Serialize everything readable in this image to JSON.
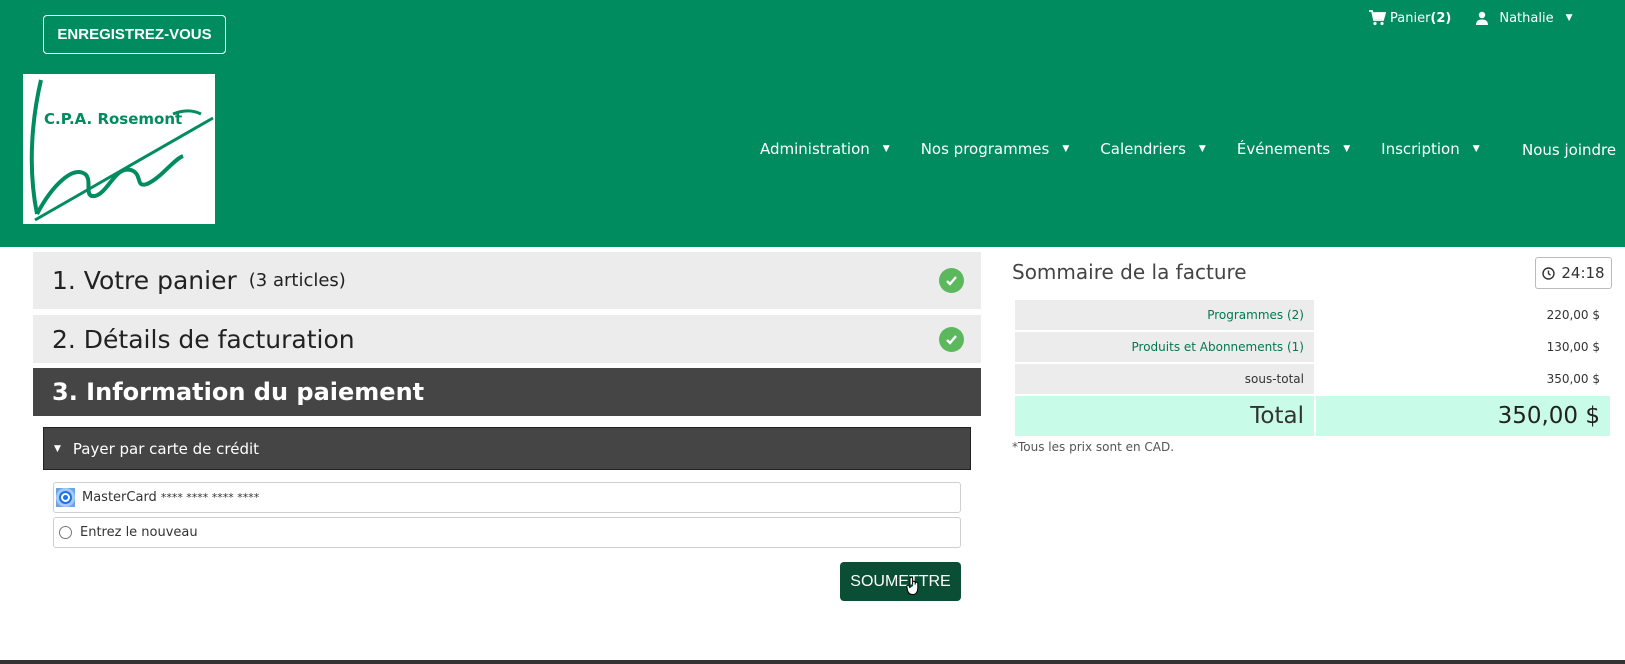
{
  "header": {
    "register_label": "ENREGISTREZ-VOUS",
    "cart_label": "Panier",
    "cart_count": "(2)",
    "user_name": "Nathalie",
    "logo_text": "C.P.A. Rosemont"
  },
  "nav": {
    "items": [
      "Administration",
      "Nos programmes",
      "Calendriers",
      "Événements",
      "Inscription"
    ],
    "join_label": "Nous joindre"
  },
  "steps": {
    "step1_title": "1. Votre panier",
    "step1_count": "(3 articles)",
    "step2_title": "2. Détails de facturation",
    "step3_title": "3. Information du paiement"
  },
  "payment": {
    "panel_label": "Payer par carte de crédit",
    "card_label": "MasterCard",
    "card_mask": "**** **** **** ****",
    "new_card_label": "Entrez le nouveau",
    "submit_label": "SOUMETTRE"
  },
  "summary": {
    "title": "Sommaire de la facture",
    "timer": "24:18",
    "rows": [
      {
        "label": "Programmes (2)",
        "value": "220,00 $"
      },
      {
        "label": "Produits et Abonnements (1)",
        "value": "130,00 $"
      },
      {
        "label": "sous-total",
        "value": "350,00 $"
      }
    ],
    "total_label": "Total",
    "total_value": "350,00 $",
    "note": "*Tous les prix sont en CAD."
  },
  "colors": {
    "brand_green": "#008c5f",
    "dark_panel": "#454545",
    "submit_green": "#0a4f35",
    "check_green": "#5cb85c",
    "total_bg": "#c8fbe8"
  }
}
